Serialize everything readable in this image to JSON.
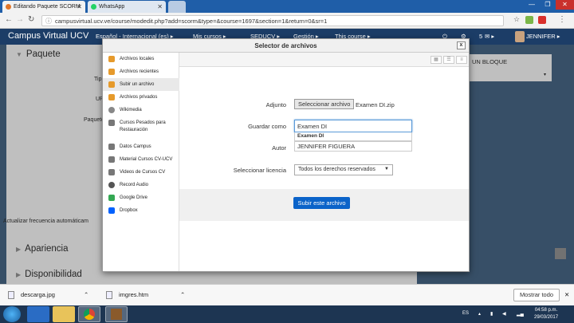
{
  "browser": {
    "tabs": [
      {
        "title": "Editando Paquete SCORM",
        "active": true
      },
      {
        "title": "WhatsApp",
        "active": false
      }
    ],
    "url": "campusvirtual.ucv.ve/course/modedit.php?add=scorm&type=&course=1697&section=1&return=0&sr=1"
  },
  "navbar": {
    "brand": "Campus Virtual UCV",
    "language": "Español - Internacional (es) ▸",
    "my_courses": "Mis cursos ▸",
    "sedcv": "SEDUCV ▸",
    "gestion": "Gestión ▸",
    "this_course": "This course ▸",
    "notifications": "5",
    "user": "JENNIFER ▸"
  },
  "page": {
    "section_paquete": "Paquete",
    "label_tipo": "Tip",
    "label_ur": "UR",
    "label_paquete": "Paquete",
    "update_freq": "Actualizar frecuencia automáticam",
    "section_apariencia": "Apariencia",
    "section_disponibilidad": "Disponibilidad",
    "right_block": "UN BLOQUE"
  },
  "modal": {
    "title": "Selector de archivos",
    "close": "x",
    "repositories": [
      {
        "label": "Archivos locales",
        "icon": "folder-icon",
        "color": "#e69a2b"
      },
      {
        "label": "Archivos recientes",
        "icon": "recent-icon",
        "color": "#e69a2b"
      },
      {
        "label": "Subir un archivo",
        "icon": "upload-icon",
        "color": "#e69a2b",
        "selected": true
      },
      {
        "label": "Archivos privados",
        "icon": "private-files-icon",
        "color": "#e69a2b"
      },
      {
        "label": "Wikimedia",
        "icon": "wikimedia-icon",
        "color": "#888888"
      },
      {
        "label": "Cursos Pesados para Restauración",
        "icon": "server-icon",
        "color": "#777777"
      },
      {
        "label": "Datos Campus",
        "icon": "server-icon",
        "color": "#777777"
      },
      {
        "label": "Material Cursos CV-UCV",
        "icon": "server-icon",
        "color": "#777777"
      },
      {
        "label": "Videos de Cursos CV",
        "icon": "server-icon",
        "color": "#777777"
      },
      {
        "label": "Record Audio",
        "icon": "microphone-icon",
        "color": "#555555"
      },
      {
        "label": "Google Drive",
        "icon": "google-drive-icon",
        "color": "#34a853"
      },
      {
        "label": "Dropbox",
        "icon": "dropbox-icon",
        "color": "#0061fe"
      }
    ],
    "form": {
      "attachment_label": "Adjunto",
      "choose_button": "Seleccionar archivo",
      "chosen_file": "Examen DI.zip",
      "saveas_label": "Guardar como",
      "saveas_value": "Examen DI",
      "autocomplete_suggestion": "Examen DI",
      "author_label": "Autor",
      "author_value": "JENNIFER FIGUERA",
      "license_label": "Seleccionar licencia",
      "license_value": "Todos los derechos reservados",
      "upload_button": "Subir este archivo"
    }
  },
  "downloads": {
    "items": [
      "descarga.jpg",
      "imgres.htm"
    ],
    "show_all": "Mostrar todo"
  },
  "taskbar": {
    "lang": "ES",
    "time": "04:58 p.m.",
    "date": "29/03/2017"
  }
}
